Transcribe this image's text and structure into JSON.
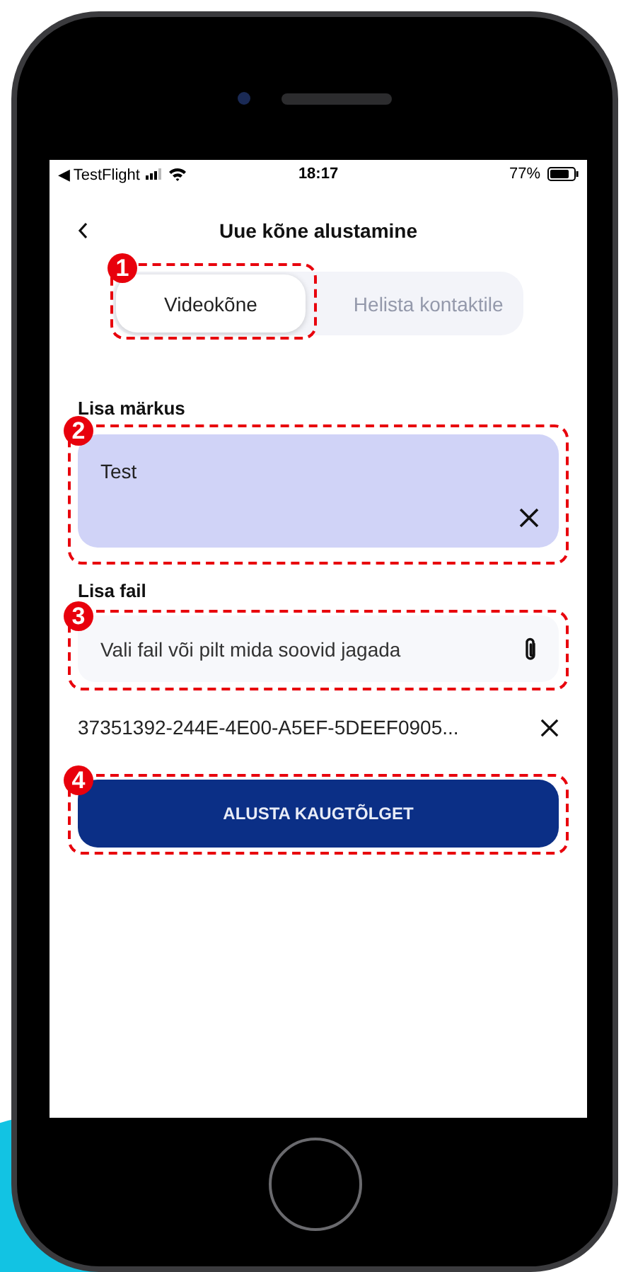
{
  "status_bar": {
    "back_app": "◀ TestFlight",
    "time": "18:17",
    "battery": "77%"
  },
  "header": {
    "title": "Uue kõne alustamine"
  },
  "tabs": [
    {
      "label": "Videokõne",
      "selected": true
    },
    {
      "label": "Helista kontaktile",
      "selected": false
    }
  ],
  "note": {
    "label": "Lisa märkus",
    "value": "Test"
  },
  "file": {
    "label": "Lisa fail",
    "placeholder": "Vali fail või pilt mida soovid jagada",
    "attached": "37351392-244E-4E00-A5EF-5DEEF0905..."
  },
  "start_button": "ALUSTA KAUGTÕLGET",
  "callouts": [
    "1",
    "2",
    "3",
    "4"
  ]
}
